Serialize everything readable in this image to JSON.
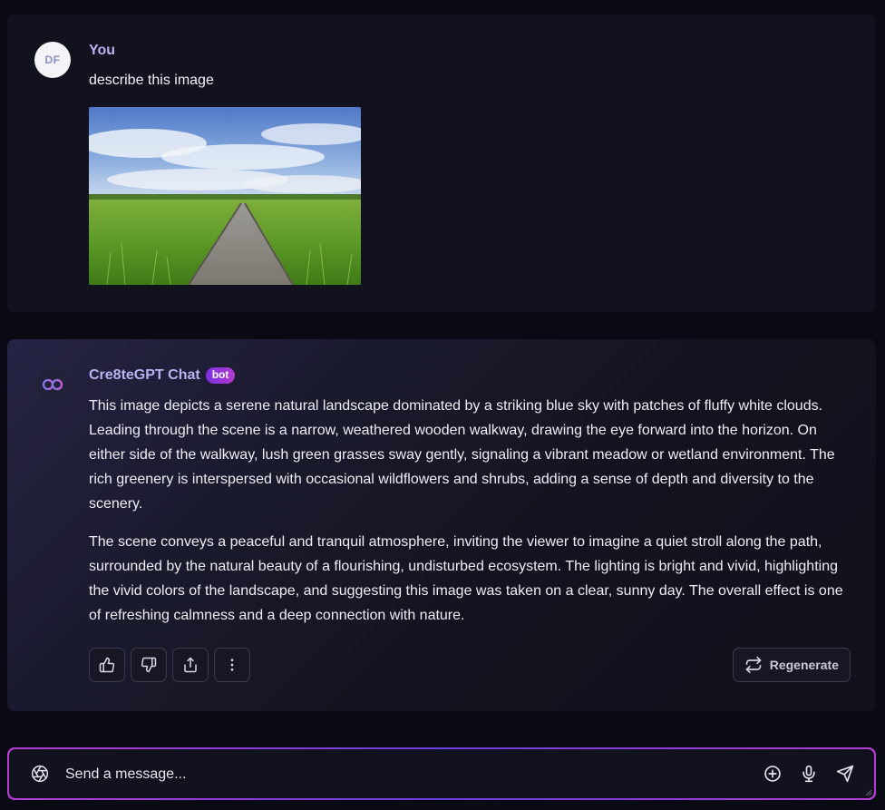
{
  "user_message": {
    "avatar_initials": "DF",
    "author": "You",
    "text": "describe this image"
  },
  "bot_message": {
    "author": "Cre8teGPT Chat",
    "badge": "bot",
    "paragraphs": [
      "This image depicts a serene natural landscape dominated by a striking blue sky with patches of fluffy white clouds. Leading through the scene is a narrow, weathered wooden walkway, drawing the eye forward into the horizon. On either side of the walkway, lush green grasses sway gently, signaling a vibrant meadow or wetland environment. The rich greenery is interspersed with occasional wildflowers and shrubs, adding a sense of depth and diversity to the scenery.",
      "The scene conveys a peaceful and tranquil atmosphere, inviting the viewer to imagine a quiet stroll along the path, surrounded by the natural beauty of a flourishing, undisturbed ecosystem. The lighting is bright and vivid, highlighting the vivid colors of the landscape, and suggesting this image was taken on a clear, sunny day. The overall effect is one of refreshing calmness and a deep connection with nature."
    ],
    "actions": {
      "like_icon": "thumbs-up-icon",
      "dislike_icon": "thumbs-down-icon",
      "share_icon": "share-icon",
      "more_icon": "more-vertical-icon",
      "regenerate_label": "Regenerate"
    }
  },
  "composer": {
    "placeholder": "Send a message...",
    "left_icon": "aperture-icon",
    "add_icon": "plus-circle-icon",
    "mic_icon": "microphone-icon",
    "send_icon": "send-icon"
  },
  "colors": {
    "background": "#0a0a14",
    "card": "#12121f",
    "accent_purple": "#b8b2f0",
    "badge_gradient_start": "#7b2fe0",
    "badge_gradient_end": "#b33bd0",
    "composer_border": "#b63bd6"
  }
}
